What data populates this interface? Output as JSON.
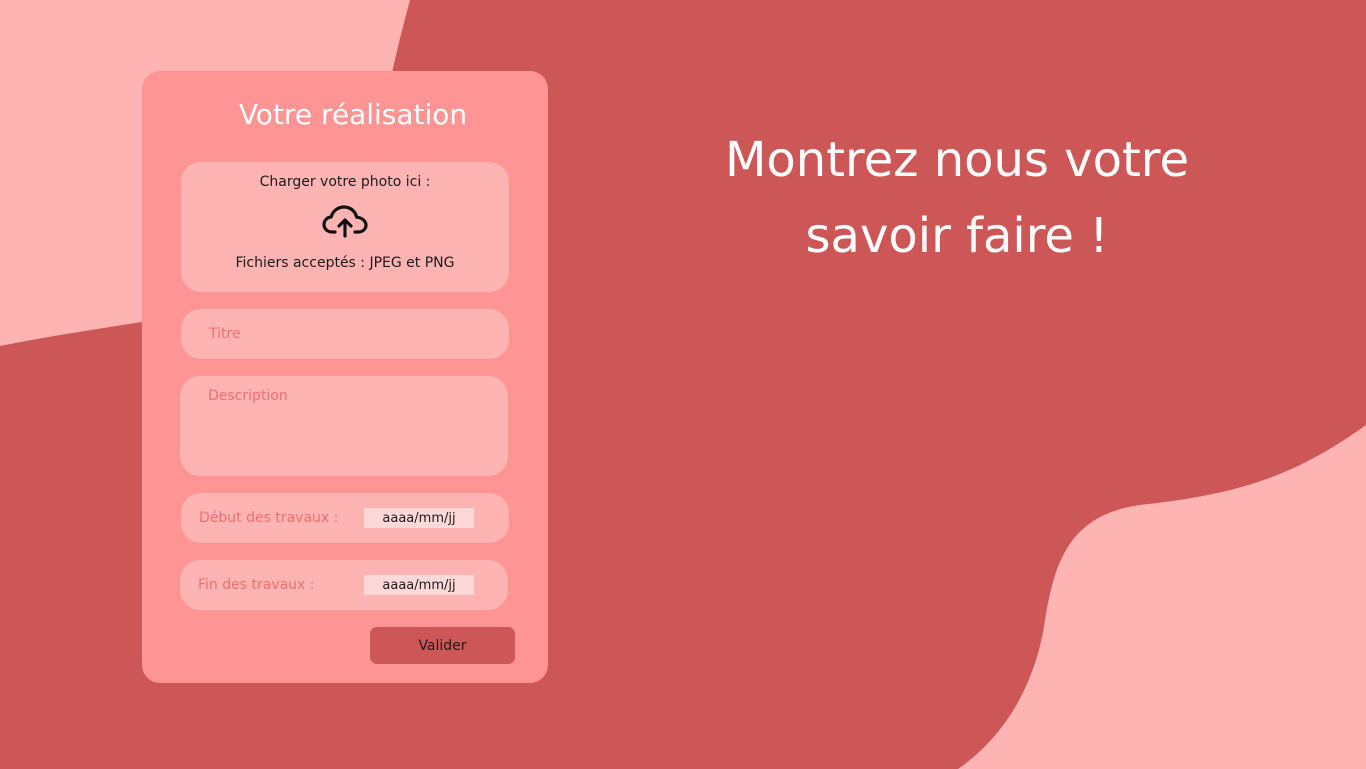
{
  "colors": {
    "background": "#cd5757",
    "blob": "#ffb4b4",
    "card": "#ff9494",
    "field": "#ffb4b4",
    "button": "#cd5757",
    "placeholder": "#f06e6e",
    "date_box": "#ffd9d9"
  },
  "form": {
    "title": "Votre réalisation",
    "upload": {
      "label": "Charger votre photo ici :",
      "icon": "cloud-upload-icon",
      "accepted": "Fichiers acceptés : JPEG et PNG"
    },
    "titre_placeholder": "Titre",
    "description_placeholder": "Description",
    "debut_label": "Début des travaux :",
    "debut_value": "aaaa/mm/jj",
    "fin_label": "Fin des travaux :",
    "fin_value": "aaaa/mm/jj",
    "submit_label": "Valider"
  },
  "headline": {
    "line1": "Montrez nous votre",
    "line2": "savoir faire !"
  }
}
